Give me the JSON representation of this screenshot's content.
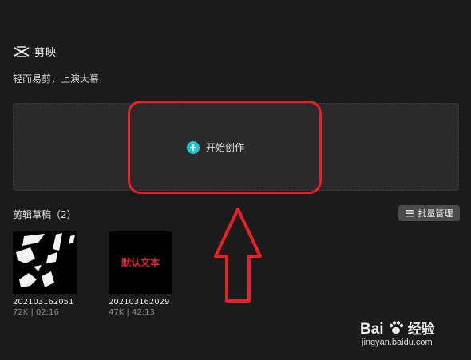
{
  "app": {
    "name": "剪映",
    "tagline": "轻而易剪，上演大幕"
  },
  "create": {
    "label": "开始创作"
  },
  "drafts": {
    "title": "剪辑草稿（2）",
    "batch_label": "批量管理",
    "items": [
      {
        "name": "202103162051",
        "meta": "72K | 02:16",
        "thumb_text": ""
      },
      {
        "name": "202103162029",
        "meta": "47K | 42:13",
        "thumb_text": "默认文本"
      }
    ]
  },
  "watermark": {
    "brand": "Bai",
    "brand_cn": "经验",
    "site": "jingyan.baidu.com"
  },
  "colors": {
    "accent": "#20c4cf",
    "highlight": "#e81f26",
    "background": "#1b1b1c"
  }
}
